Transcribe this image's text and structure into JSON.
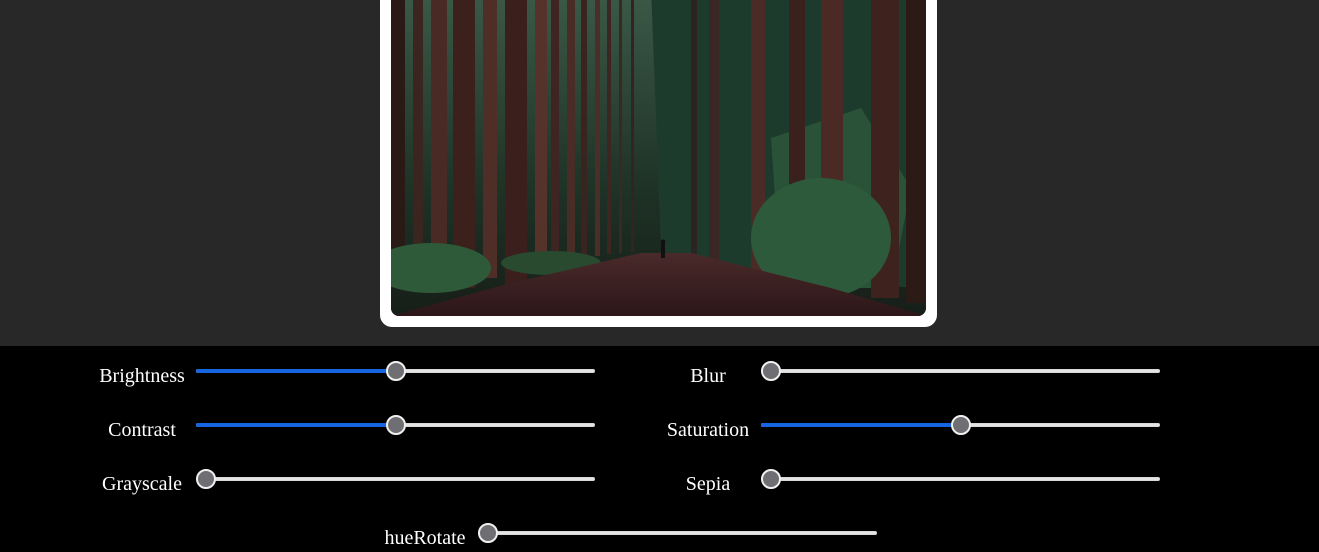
{
  "preview": {
    "image_alt": "forest path photo"
  },
  "controls": {
    "brightness": {
      "label": "Brightness",
      "value": 0.5
    },
    "blur": {
      "label": "Blur",
      "value": 0
    },
    "contrast": {
      "label": "Contrast",
      "value": 0.5
    },
    "saturation": {
      "label": "Saturation",
      "value": 0.5
    },
    "grayscale": {
      "label": "Grayscale",
      "value": 0
    },
    "sepia": {
      "label": "Sepia",
      "value": 0
    },
    "hueRotate": {
      "label": "hueRotate",
      "value": 0
    }
  },
  "colors": {
    "accent": "#1565e0",
    "track": "#e4e4e4",
    "thumb": "#6e6e73",
    "preview_bg": "#282828",
    "controls_bg": "#000000"
  }
}
